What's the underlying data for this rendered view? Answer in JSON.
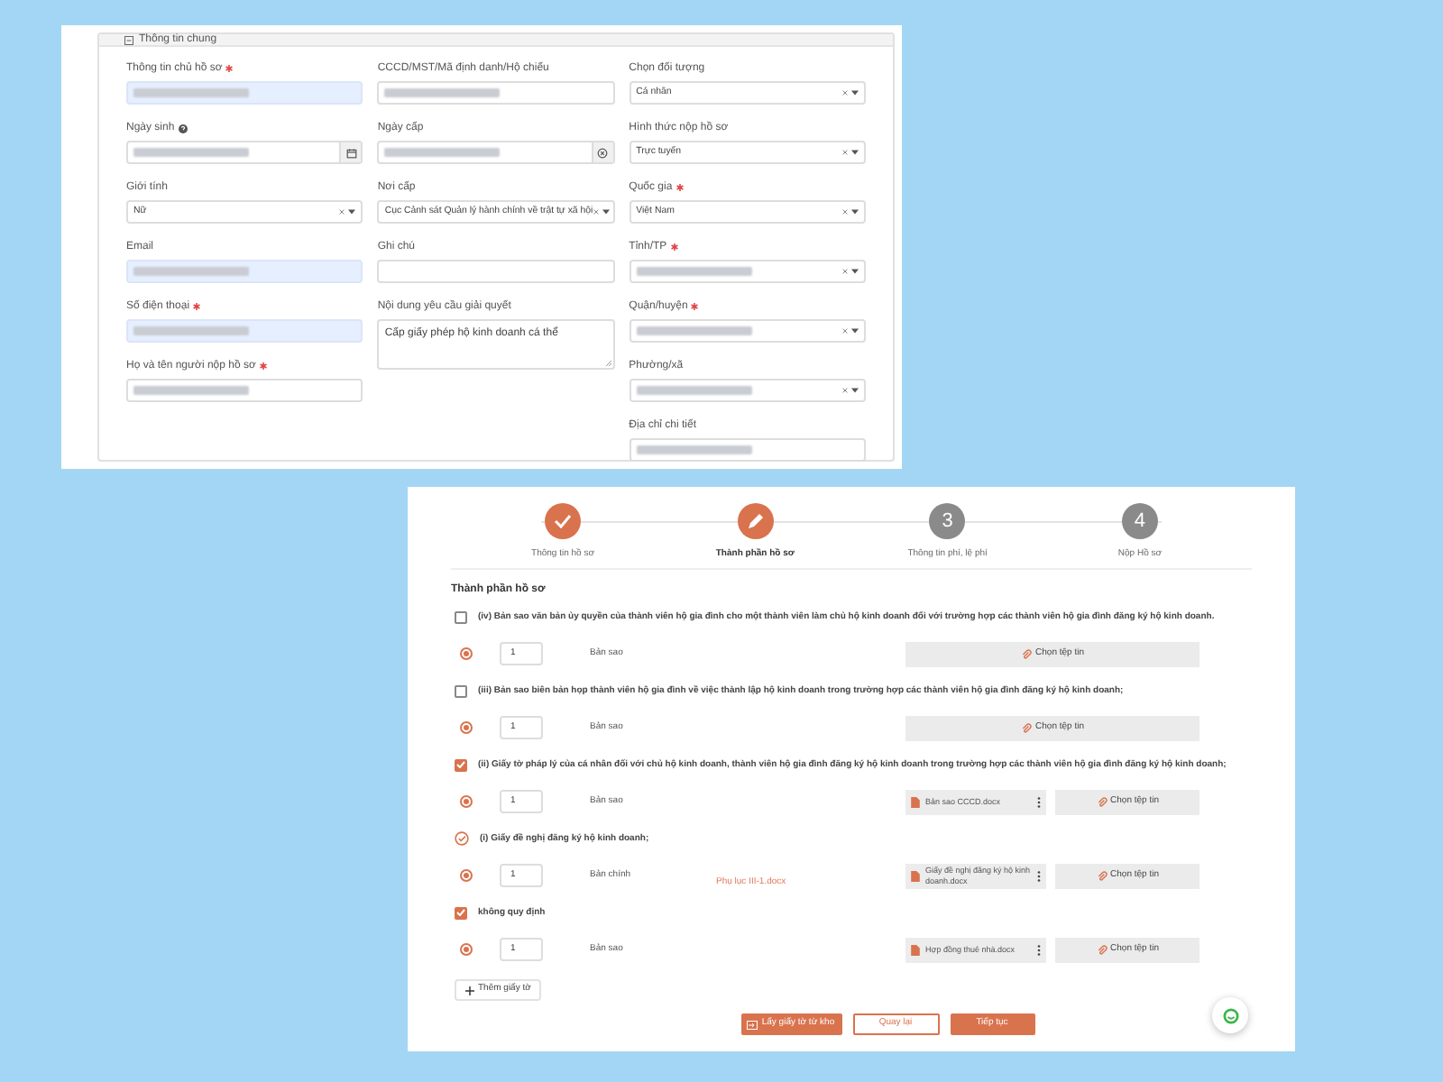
{
  "general_info": {
    "title": "Thông tin chung",
    "columns": [
      [
        {
          "label": "Thông tin chủ hồ sơ",
          "required": true,
          "kind": "text",
          "highlighted": true,
          "redacted": true
        },
        {
          "label": "Ngày sinh",
          "help": true,
          "kind": "date",
          "highlighted": false,
          "redacted": true
        },
        {
          "label": "Giới tính",
          "kind": "select",
          "value": "Nữ",
          "highlighted": false
        },
        {
          "label": "Email",
          "kind": "text",
          "highlighted": true,
          "redacted": true
        },
        {
          "label": "Số điện thoại",
          "required": true,
          "kind": "text",
          "highlighted": true,
          "redacted": true
        },
        {
          "label": "Họ và tên người nộp hồ sơ",
          "required": true,
          "kind": "text",
          "highlighted": false,
          "redacted": true
        }
      ],
      [
        {
          "label": "CCCD/MST/Mã định danh/Hộ chiếu",
          "kind": "text",
          "highlighted": false,
          "redacted": true
        },
        {
          "label": "Ngày cấp",
          "kind": "date-clear",
          "highlighted": false,
          "redacted": true
        },
        {
          "label": "Nơi cấp",
          "kind": "select",
          "value": "Cục Cảnh sát Quản lý hành chính về trật tự xã hội",
          "highlighted": false
        },
        {
          "label": "Ghi chú",
          "kind": "text",
          "highlighted": false
        },
        {
          "label": "Nội dung yêu cầu giải quyết",
          "kind": "textarea",
          "value": "Cấp giấy phép hộ kinh doanh cá thể",
          "highlighted": false
        }
      ],
      [
        {
          "label": "Chọn đối tượng",
          "kind": "select",
          "value": "Cá nhân",
          "highlighted": false
        },
        {
          "label": "Hình thức nộp hồ sơ",
          "kind": "select",
          "value": "Trực tuyến",
          "highlighted": false
        },
        {
          "label": "Quốc gia",
          "required": true,
          "kind": "select",
          "value": "Việt Nam",
          "highlighted": false
        },
        {
          "label": "Tỉnh/TP",
          "required": true,
          "kind": "select",
          "highlighted": false,
          "redacted": true
        },
        {
          "label": "Quận/huyện",
          "required": true,
          "kind": "select",
          "highlighted": false,
          "redacted": true
        },
        {
          "label": "Phường/xã",
          "kind": "select",
          "highlighted": false,
          "redacted": true
        },
        {
          "label": "Địa chỉ chi tiết",
          "kind": "text",
          "highlighted": false,
          "redacted": true
        }
      ]
    ]
  },
  "steps": [
    {
      "kind": "done",
      "label": "Thông tin hồ sơ"
    },
    {
      "kind": "current",
      "label": "Thành phần hồ sơ"
    },
    {
      "kind": "pending",
      "number": "3",
      "label": "Thông tin phí, lệ phí"
    },
    {
      "kind": "pending",
      "number": "4",
      "label": "Nộp Hồ sơ"
    }
  ],
  "documents_title": "Thành phần hồ sơ",
  "documents": [
    {
      "kind": "checkbox",
      "checked": false,
      "title": "(iv) Bản sao văn bản ủy quyền của thành viên hộ gia đình cho một thành viên làm chủ hộ kinh doanh đối với trường hợp các thành viên hộ gia đình đăng ký hộ kinh doanh.",
      "selected": true,
      "quantity": "1",
      "copy_type": "Bản sao",
      "button": "Chọn tệp tin"
    },
    {
      "kind": "checkbox",
      "checked": false,
      "title": "(iii) Bản sao biên bản họp thành viên hộ gia đình về việc thành lập hộ kinh doanh trong trường hợp các thành viên hộ gia đình đăng ký hộ kinh doanh;",
      "selected": true,
      "quantity": "1",
      "copy_type": "Bản sao",
      "button": "Chọn tệp tin"
    },
    {
      "kind": "checkbox",
      "checked": true,
      "title": "(ii) Giấy tờ pháp lý của cá nhân đối với chủ hộ kinh doanh, thành viên hộ gia đình đăng ký hộ kinh doanh trong trường hợp các thành viên hộ gia đình đăng ký hộ kinh doanh;",
      "selected": true,
      "quantity": "1",
      "copy_type": "Bản sao",
      "file": "Bản sao CCCD.docx",
      "button": "Chọn tệp tin"
    },
    {
      "kind": "mandatory",
      "title": "(i) Giấy đề nghị đăng ký hộ kinh doanh;",
      "selected": true,
      "quantity": "1",
      "copy_type": "Bản chính",
      "template": "Phụ lục III-1.docx",
      "file": "Giấy đề nghị đăng ký hộ kinh doanh.docx",
      "button": "Chọn tệp tin"
    },
    {
      "kind": "checkbox",
      "checked": true,
      "title": "không quy định",
      "selected": true,
      "quantity": "1",
      "copy_type": "Bản sao",
      "file": "Hợp đồng thuê nhà.docx",
      "button": "Chọn tệp tin"
    }
  ],
  "add_button": "Thêm giấy tờ",
  "footer_buttons": [
    {
      "kind": "primary-icon",
      "label": "Lấy giấy tờ từ kho"
    },
    {
      "kind": "outline",
      "label": "Quay lại"
    },
    {
      "kind": "primary",
      "label": "Tiếp tục"
    }
  ]
}
